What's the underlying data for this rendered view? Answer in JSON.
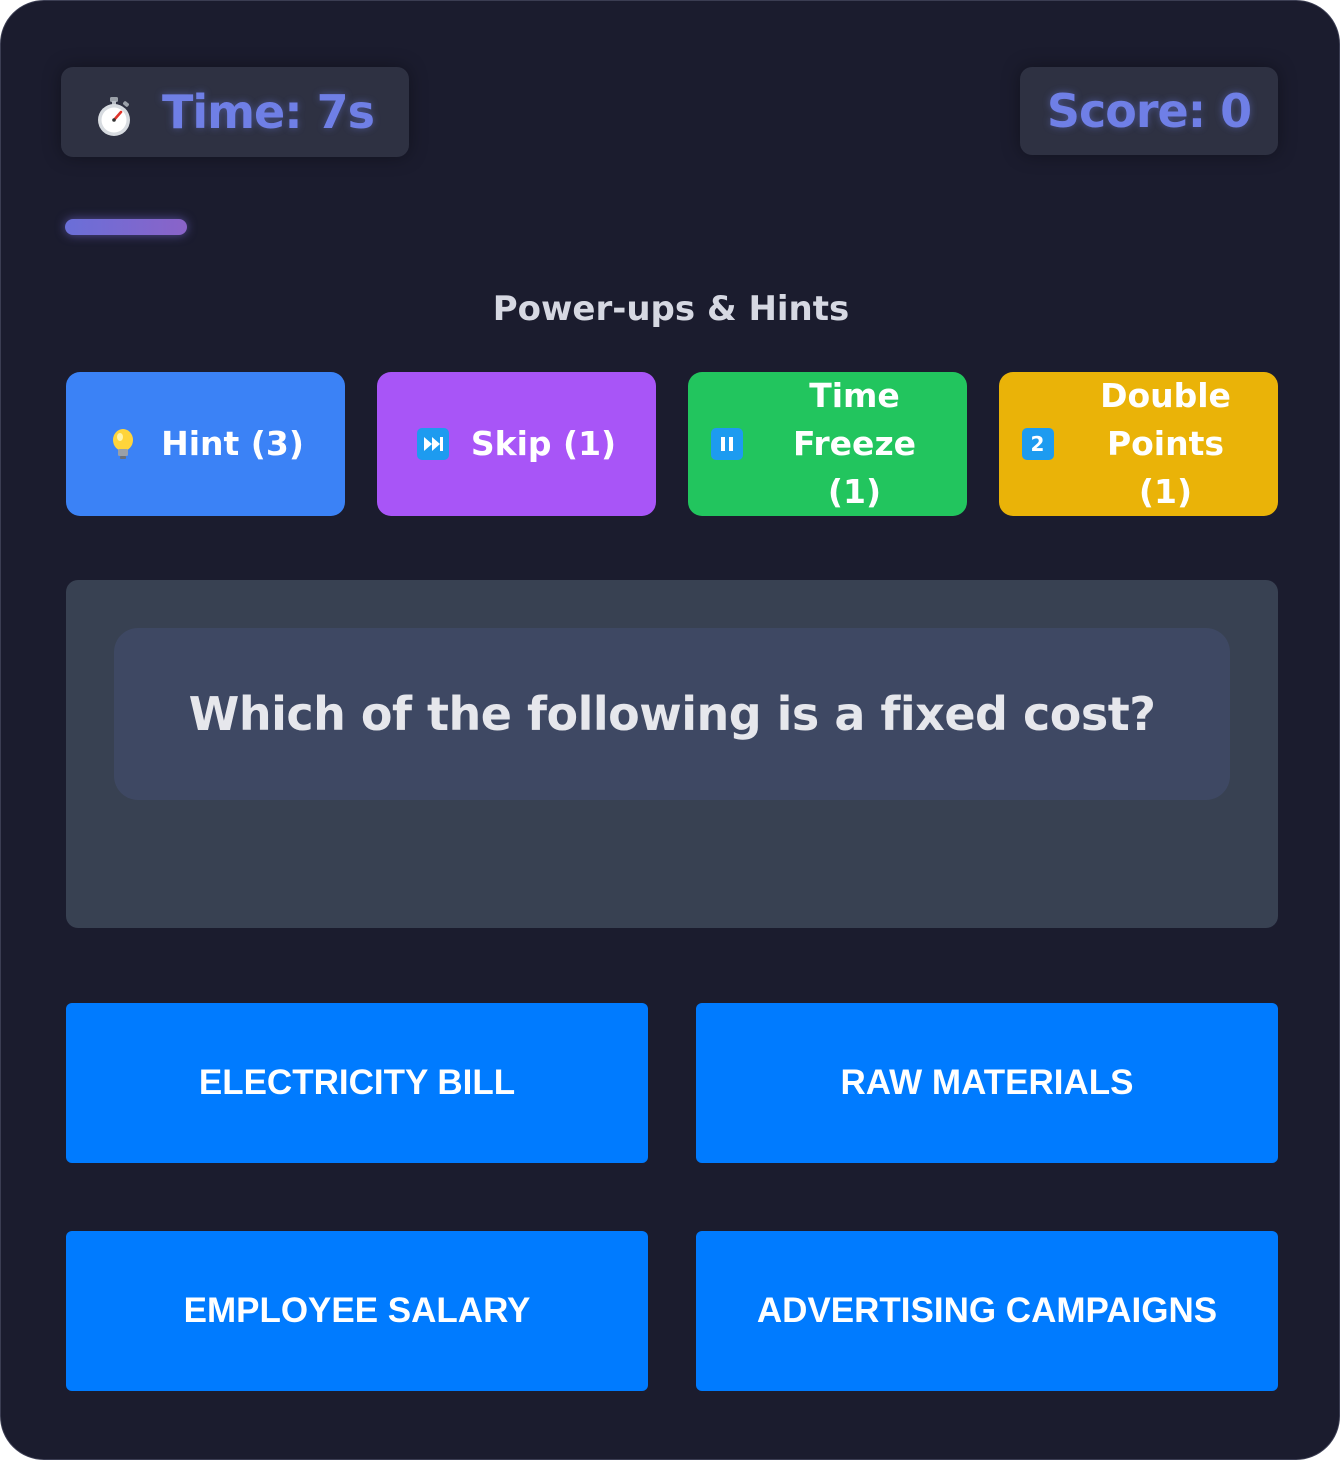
{
  "timer": {
    "icon": "stopwatch-icon",
    "label": "Time: 7s"
  },
  "score": {
    "label": "Score: 0"
  },
  "time_progress": {
    "fraction_remaining": 0.1
  },
  "powerups": {
    "title": "Power-ups & Hints",
    "items": [
      {
        "icon": "lightbulb-icon",
        "label": "Hint (3)",
        "color": "#3b82f6"
      },
      {
        "icon": "fast-forward-icon",
        "label": "Skip (1)",
        "color": "#a855f7"
      },
      {
        "icon": "pause-icon",
        "label": "Time Freeze (1)",
        "color": "#22c55e"
      },
      {
        "icon": "keycap-2-icon",
        "icon_text": "2",
        "label": "Double Points (1)",
        "color": "#eab308"
      }
    ]
  },
  "question": {
    "text": "Which of the following is a fixed cost?"
  },
  "answers": [
    {
      "label": "ELECTRICITY BILL"
    },
    {
      "label": "RAW MATERIALS"
    },
    {
      "label": "EMPLOYEE SALARY"
    },
    {
      "label": "ADVERTISING CAMPAIGNS"
    }
  ],
  "colors": {
    "background": "#1b1c2e",
    "accent": "#6f7fe6",
    "answer_button": "#007bff",
    "question_panel": "#384152"
  }
}
